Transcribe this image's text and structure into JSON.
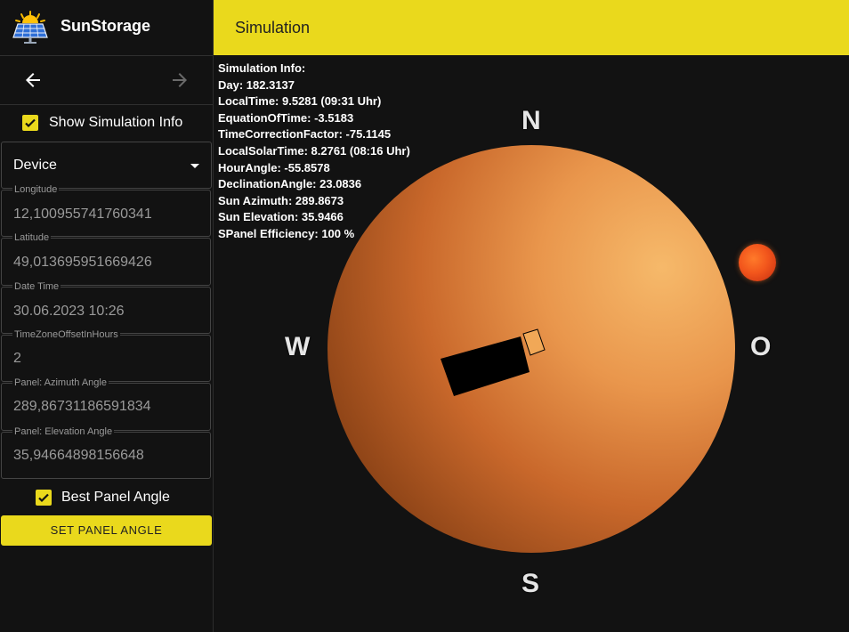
{
  "app": {
    "title": "SunStorage"
  },
  "header": {
    "title": "Simulation"
  },
  "sidebar": {
    "show_info_label": "Show Simulation Info",
    "device_value": "Device",
    "fields": [
      {
        "label": "Longitude",
        "value": "12,100955741760341"
      },
      {
        "label": "Latitude",
        "value": "49,013695951669426"
      },
      {
        "label": "Date Time",
        "value": "30.06.2023 10:26"
      },
      {
        "label": "TimeZoneOffsetInHours",
        "value": "2"
      },
      {
        "label": "Panel: Azimuth Angle",
        "value": "289,86731186591834"
      },
      {
        "label": "Panel: Elevation Angle",
        "value": "35,94664898156648"
      }
    ],
    "best_angle_label": "Best Panel Angle",
    "set_button": "SET PANEL ANGLE"
  },
  "simulation": {
    "info": [
      "Simulation Info:",
      "Day: 182.3137",
      "LocalTime: 9.5281 (09:31 Uhr)",
      "EquationOfTime: -3.5183",
      "TimeCorrectionFactor: -75.1145",
      "LocalSolarTime: 8.2761 (08:16 Uhr)",
      "HourAngle: -55.8578",
      "DeclinationAngle: 23.0836",
      "Sun Azimuth: 289.8673",
      "Sun Elevation: 35.9466",
      "SPanel Efficiency: 100 %"
    ],
    "compass": {
      "north": "N",
      "south": "S",
      "west": "W",
      "east": "O"
    }
  },
  "colors": {
    "accent": "#ead91c",
    "background": "#121212",
    "globe": "#e9964c"
  },
  "icons": {
    "back": "arrow-left-icon",
    "forward": "arrow-right-icon",
    "logo": "solar-panel-logo-icon"
  }
}
